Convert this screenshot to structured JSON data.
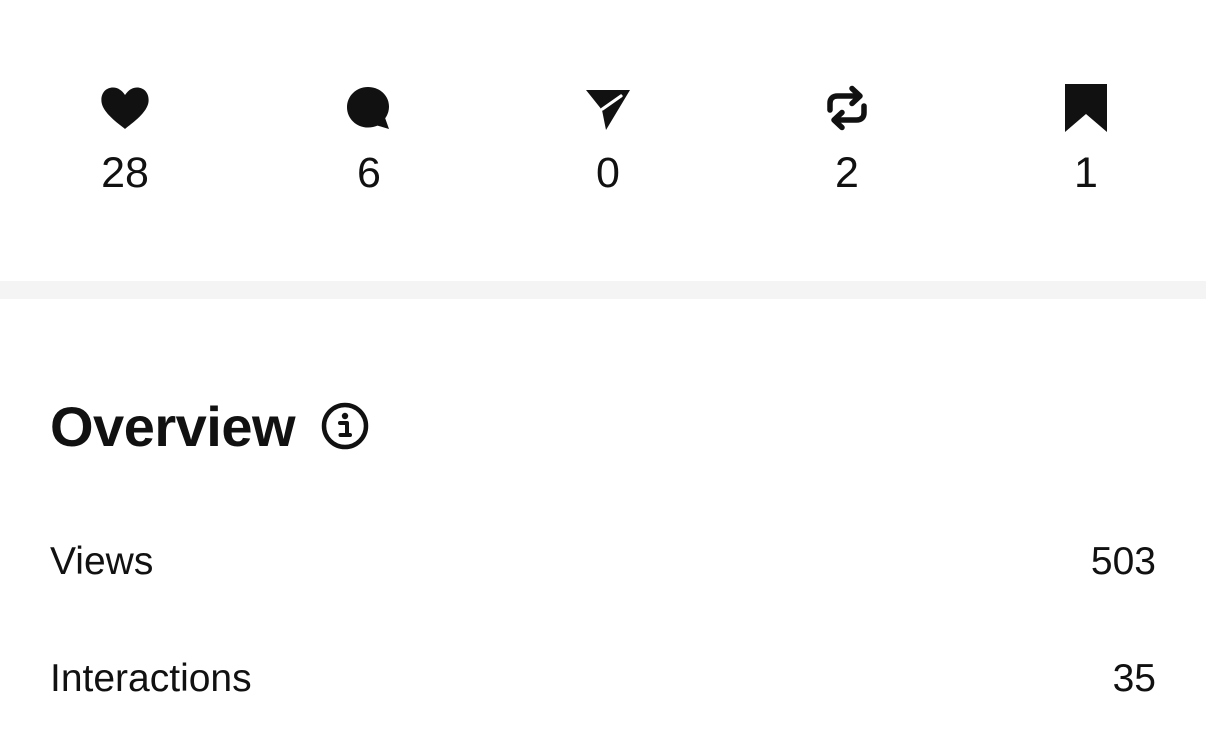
{
  "stats": [
    {
      "key": "likes",
      "icon": "heart-icon",
      "count": "28"
    },
    {
      "key": "comments",
      "icon": "comment-bubble-icon",
      "count": "6"
    },
    {
      "key": "shares",
      "icon": "send-icon",
      "count": "0"
    },
    {
      "key": "reposts",
      "icon": "repost-icon",
      "count": "2"
    },
    {
      "key": "saves",
      "icon": "bookmark-icon",
      "count": "1"
    }
  ],
  "overview": {
    "title": "Overview",
    "info_icon": "info-icon",
    "metrics": [
      {
        "label": "Views",
        "value": "503"
      },
      {
        "label": "Interactions",
        "value": "35"
      }
    ]
  },
  "colors": {
    "text": "#111111",
    "background": "#ffffff",
    "divider": "#f4f4f5"
  }
}
